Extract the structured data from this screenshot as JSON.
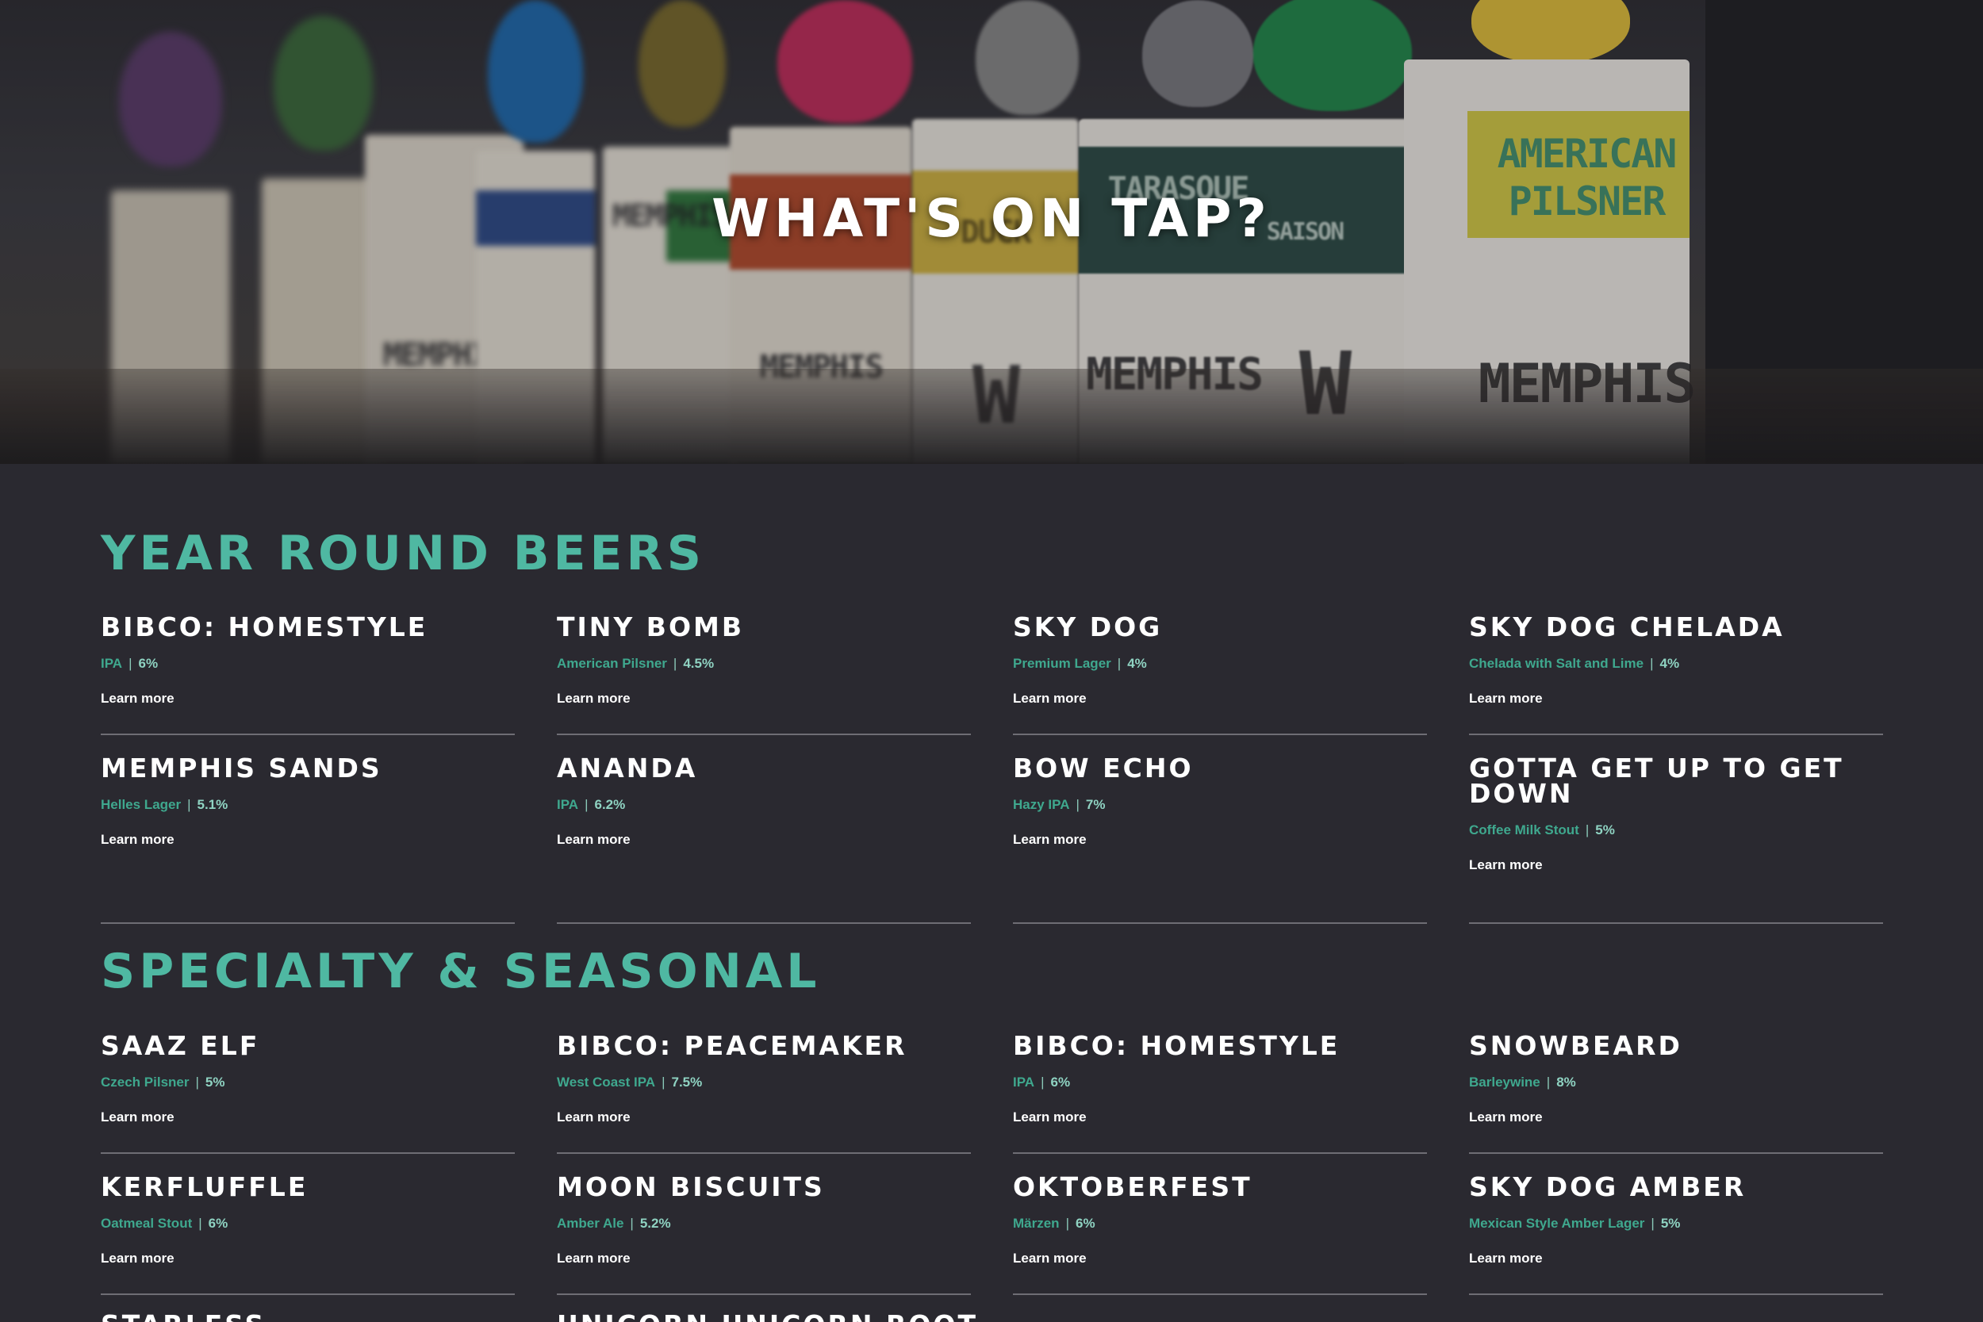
{
  "hero": {
    "title": "WHAT'S ON TAP?",
    "tap_labels": [
      "MEMPHIS",
      "MEMPHIS",
      "MEMPHIS",
      "DUCK",
      "W",
      "MEMPHIS",
      "TARASQUE",
      "SAISON",
      "W",
      "AMERICAN",
      "PILSNER",
      "MEMPHIS"
    ]
  },
  "colors": {
    "accent": "#4fb8a2",
    "background": "#2a2930",
    "divider": "#6e6d74"
  },
  "sections": [
    {
      "title": "YEAR ROUND BEERS",
      "beers": [
        {
          "name": "BIBCO: HOMESTYLE",
          "style": "IPA",
          "abv": "6%",
          "link": "Learn more"
        },
        {
          "name": "TINY BOMB",
          "style": "American Pilsner",
          "abv": "4.5%",
          "link": "Learn more"
        },
        {
          "name": "SKY DOG",
          "style": "Premium Lager",
          "abv": "4%",
          "link": "Learn more"
        },
        {
          "name": "SKY DOG CHELADA",
          "style": "Chelada with Salt and Lime",
          "abv": "4%",
          "link": "Learn more"
        },
        {
          "name": "MEMPHIS SANDS",
          "style": "Helles Lager",
          "abv": "5.1%",
          "link": "Learn more"
        },
        {
          "name": "ANANDA",
          "style": "IPA",
          "abv": "6.2%",
          "link": "Learn more"
        },
        {
          "name": "BOW ECHO",
          "style": "Hazy IPA",
          "abv": "7%",
          "link": "Learn more"
        },
        {
          "name": "GOTTA GET UP TO GET DOWN",
          "style": "Coffee Milk Stout",
          "abv": "5%",
          "link": "Learn more"
        }
      ]
    },
    {
      "title": "SPECIALTY & SEASONAL",
      "beers": [
        {
          "name": "SAAZ ELF",
          "style": "Czech Pilsner",
          "abv": "5%",
          "link": "Learn more"
        },
        {
          "name": "BIBCO: PEACEMAKER",
          "style": "West Coast IPA",
          "abv": "7.5%",
          "link": "Learn more"
        },
        {
          "name": "BIBCO: HOMESTYLE",
          "style": "IPA",
          "abv": "6%",
          "link": "Learn more"
        },
        {
          "name": "SNOWBEARD",
          "style": "Barleywine",
          "abv": "8%",
          "link": "Learn more"
        },
        {
          "name": "KERFLUFFLE",
          "style": "Oatmeal Stout",
          "abv": "6%",
          "link": "Learn more"
        },
        {
          "name": "MOON BISCUITS",
          "style": "Amber Ale",
          "abv": "5.2%",
          "link": "Learn more"
        },
        {
          "name": "OKTOBERFEST",
          "style": "Märzen",
          "abv": "6%",
          "link": "Learn more"
        },
        {
          "name": "SKY DOG AMBER",
          "style": "Mexican Style Amber Lager",
          "abv": "5%",
          "link": "Learn more"
        }
      ]
    }
  ],
  "cut_off_names": [
    "STARLESS",
    "UNICORN UNICORN ROOT"
  ]
}
